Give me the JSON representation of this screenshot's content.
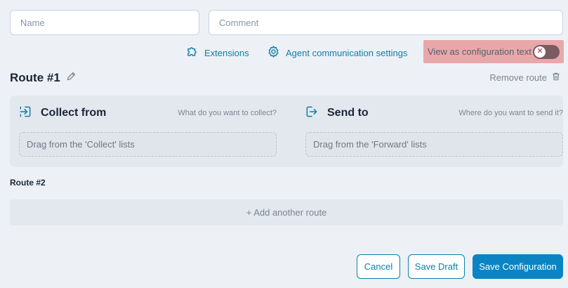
{
  "fields": {
    "name_placeholder": "Name",
    "comment_placeholder": "Comment"
  },
  "toolbar": {
    "extensions_label": "Extensions",
    "agent_settings_label": "Agent communication settings",
    "config_text_label": "View as configuration text",
    "config_text_enabled": false
  },
  "route1": {
    "title": "Route #1",
    "remove_label": "Remove route",
    "collect": {
      "title": "Collect from",
      "hint": "What do you want to collect?",
      "drop_text": "Drag from the 'Collect' lists"
    },
    "send": {
      "title": "Send to",
      "hint": "Where do you want to send it?",
      "drop_text": "Drag from the 'Forward' lists"
    }
  },
  "route2": {
    "title": "Route #2",
    "add_label": "+ Add another route"
  },
  "actions": {
    "cancel": "Cancel",
    "save_draft": "Save Draft",
    "save_config": "Save Configuration"
  },
  "colors": {
    "accent": "#0d7fa8",
    "primary_button": "#0b84c3",
    "toggle_highlight": "#e8a8aa",
    "background": "#edf1f6"
  }
}
